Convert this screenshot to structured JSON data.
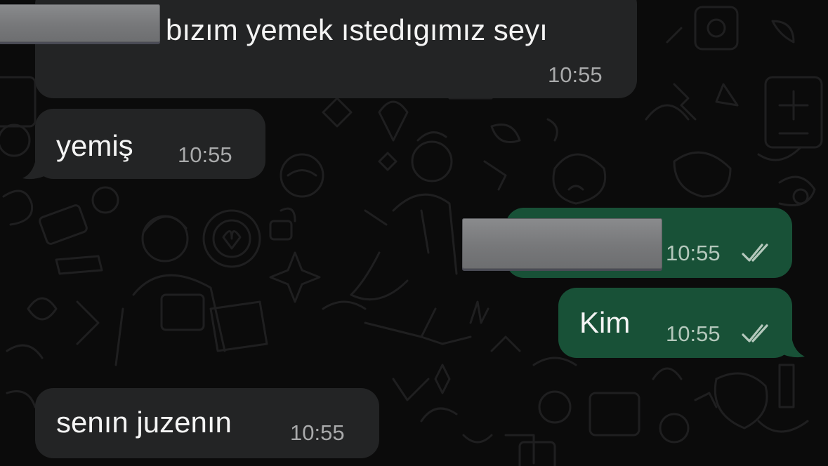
{
  "colors": {
    "background": "#0b0b0b",
    "incoming_bubble": "#232425",
    "outgoing_bubble": "#185137",
    "text": "#f4f4f4",
    "timestamp": "#a9aaab",
    "read_ticks": "#b4c8bc"
  },
  "messages": [
    {
      "direction": "incoming",
      "text": "bızım yemek ıstedıgımız seyı",
      "time": "10:55",
      "redacted_prefix": true
    },
    {
      "direction": "incoming",
      "text": "yemiş",
      "time": "10:55"
    },
    {
      "direction": "outgoing",
      "text": "",
      "time": "10:55",
      "redacted": true,
      "status_icon": "double-check-icon"
    },
    {
      "direction": "outgoing",
      "text": "Kim",
      "time": "10:55",
      "status_icon": "double-check-icon"
    },
    {
      "direction": "incoming",
      "text": "senın juzenın",
      "time": "10:55"
    }
  ]
}
